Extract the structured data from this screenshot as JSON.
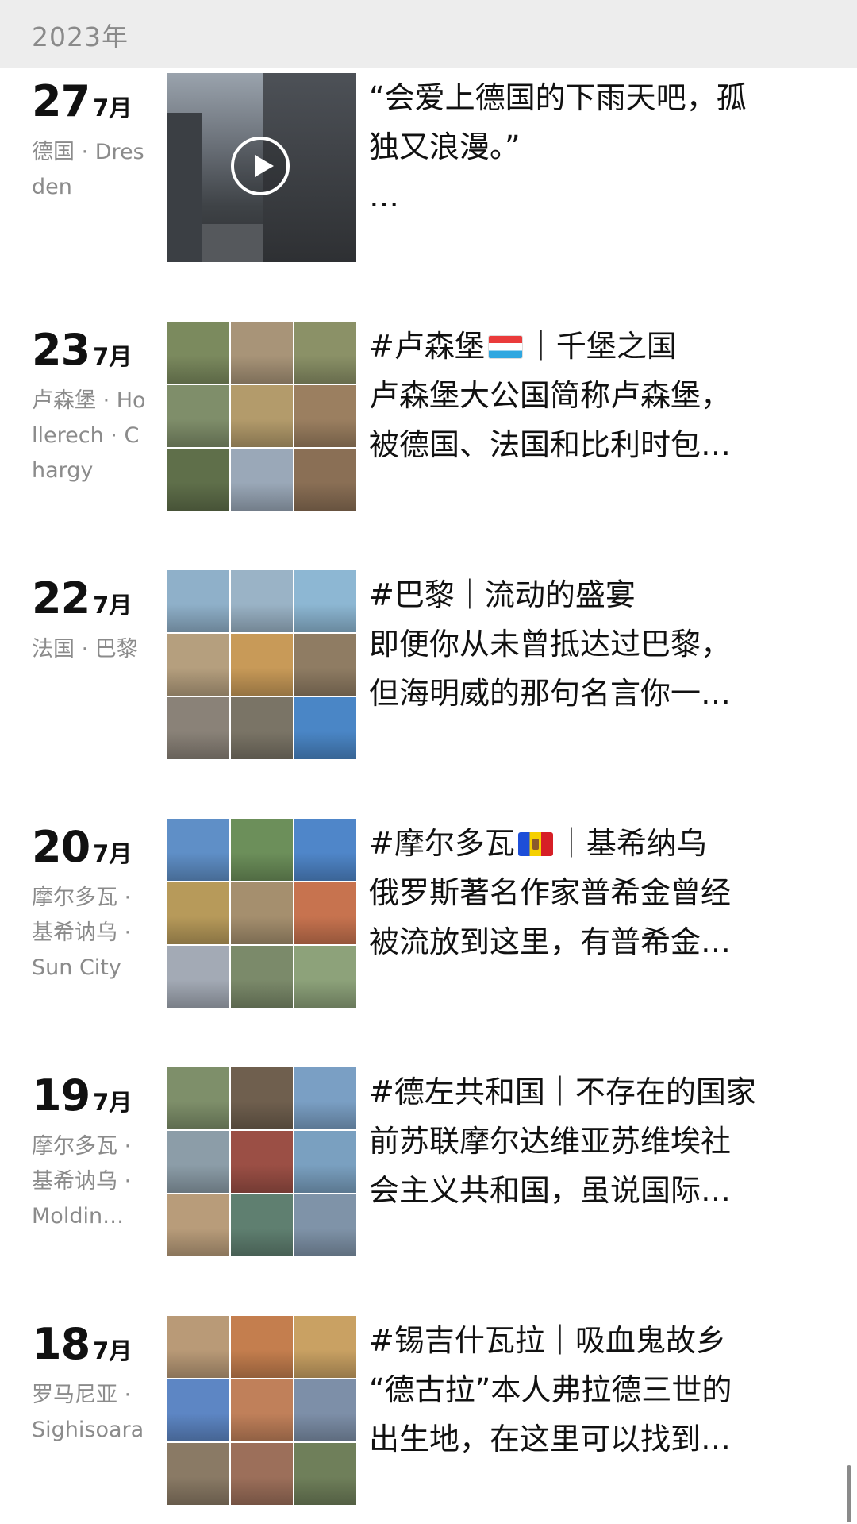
{
  "header": {
    "year": "2023年"
  },
  "posts": [
    {
      "day": "27",
      "month": "7月",
      "location": "德国 · Dresden",
      "lines": [
        "“会爱上德国的下雨天吧，孤",
        "独又浪漫。”",
        "…"
      ],
      "media": "video",
      "thumb_icon": "play-icon"
    },
    {
      "day": "23",
      "month": "7月",
      "location": "卢森堡 · Hollerech · Chargy",
      "line1_a": "#卢森堡",
      "line1_flag": "luxembourg-flag",
      "line1_b": "｜千堡之国",
      "lines": [
        "卢森堡大公国简称卢森堡，",
        "被德国、法国和比利时包…"
      ],
      "tile_colors": [
        "#7b8a5e",
        "#a89478",
        "#8b9167",
        "#7f8e6a",
        "#b39b6b",
        "#9b7f60",
        "#5f6f4a",
        "#9aa8b8",
        "#8a6f55"
      ]
    },
    {
      "day": "22",
      "month": "7月",
      "location": "法国 · 巴黎",
      "lines": [
        "#巴黎｜流动的盛宴",
        "即便你从未曾抵达过巴黎，",
        "但海明威的那句名言你一…"
      ],
      "tile_colors": [
        "#8fb0c9",
        "#9ab3c6",
        "#8db7d3",
        "#b59f7e",
        "#c89a58",
        "#8f7c63",
        "#8a8278",
        "#7a7466",
        "#4a86c6"
      ]
    },
    {
      "day": "20",
      "month": "7月",
      "location": "摩尔多瓦 · 基希讷乌 · Sun City",
      "line1_a": "#摩尔多瓦",
      "line1_flag": "moldova-flag",
      "line1_b": "｜基希纳乌",
      "lines": [
        "俄罗斯著名作家普希金曾经",
        "被流放到这里，有普希金…"
      ],
      "tile_colors": [
        "#5f8fc7",
        "#6c8f5a",
        "#4f86c9",
        "#b79a5a",
        "#a58f6e",
        "#c7734f",
        "#a3aab5",
        "#7b8a6a",
        "#8da27a"
      ]
    },
    {
      "day": "19",
      "month": "7月",
      "location": "摩尔多瓦 · 基希讷乌 · Moldin…",
      "lines": [
        "#德左共和国｜不存在的国家",
        "前苏联摩尔达维亚苏维埃社",
        "会主义共和国，虽说国际…"
      ],
      "tile_colors": [
        "#7e8f6a",
        "#6f5f4e",
        "#7a9fc4",
        "#8c9da8",
        "#9b4f45",
        "#7aa0c0",
        "#b89c7a",
        "#5f7f70",
        "#7f93a8"
      ]
    },
    {
      "day": "18",
      "month": "7月",
      "location": "罗马尼亚 · Sighisoara",
      "lines": [
        "#锡吉什瓦拉｜吸血鬼故乡",
        "“德古拉”本人弗拉德三世的",
        "出生地，在这里可以找到…"
      ],
      "tile_colors": [
        "#b99a77",
        "#c47e4e",
        "#c9a163",
        "#5d86c4",
        "#c0805a",
        "#7d8fa8",
        "#8a7a65",
        "#9c6f5a",
        "#6f7f5a"
      ]
    }
  ]
}
